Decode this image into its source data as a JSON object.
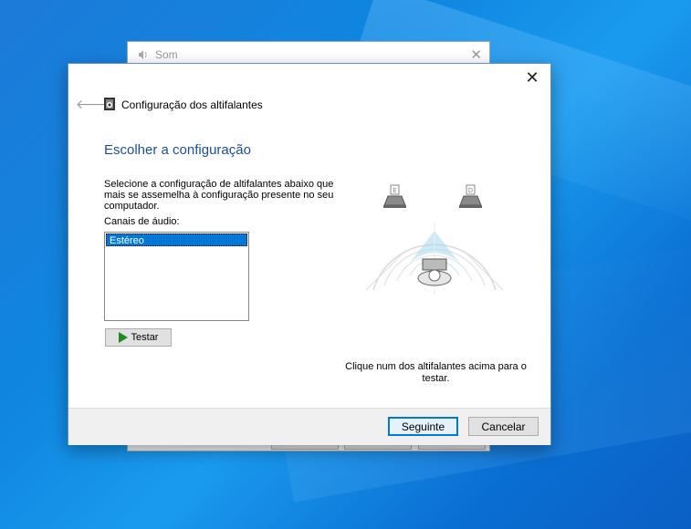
{
  "background_window": {
    "title": "Som",
    "close_icon": "close-icon"
  },
  "dialog": {
    "title": "Configuração dos altifalantes",
    "heading": "Escolher a configuração",
    "description": "Selecione a configuração de altifalantes abaixo que mais se assemelha à configuração presente no seu computador.",
    "channels_label": "Canais de áudio:",
    "channels": [
      "Estéreo"
    ],
    "selected_channel": "Estéreo",
    "test_button": "Testar",
    "speaker_hint": "Clique num dos altifalantes acima para o testar.",
    "speakers": [
      {
        "id": "left",
        "glyph": "E"
      },
      {
        "id": "right",
        "glyph": "D"
      }
    ],
    "next_button": "Seguinte",
    "cancel_button": "Cancelar"
  },
  "colors": {
    "heading": "#1a4f9e",
    "selection": "#0078d7",
    "play_icon": "#1f8a1f",
    "sound_field": "#a8d8f0"
  }
}
